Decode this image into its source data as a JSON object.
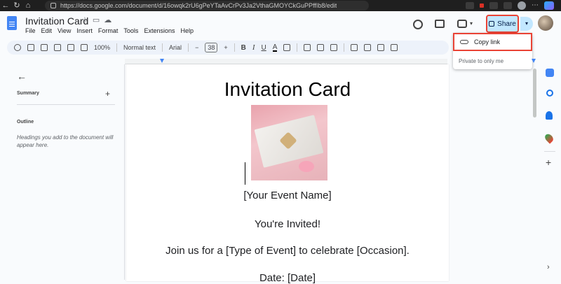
{
  "browser": {
    "url": "https://docs.google.com/document/d/16owqk2rU6gPeYTaAvCrPv3Ja2VthaGMOYCkGuPPffIb8/edit"
  },
  "doc": {
    "title": "Invitation Card",
    "menu": [
      "File",
      "Edit",
      "View",
      "Insert",
      "Format",
      "Tools",
      "Extensions",
      "Help"
    ]
  },
  "toolbar": {
    "zoom": "100%",
    "style": "Normal text",
    "font": "Arial",
    "font_size": "38",
    "bold": "B",
    "italic": "I",
    "underline": "U",
    "text_color": "A"
  },
  "share": {
    "label": "Share",
    "copy_link": "Copy link",
    "private": "Private to only me"
  },
  "outline_panel": {
    "summary": "Summary",
    "outline": "Outline",
    "hint": "Headings you add to the document will appear here."
  },
  "page": {
    "heading": "Invitation Card",
    "lines": [
      "[Your Event Name]",
      "You're Invited!",
      "Join us for a [Type of Event] to celebrate [Occasion].",
      "Date: [Date]"
    ]
  },
  "colors": {
    "share_bg": "#c2e7ff",
    "highlight": "#ea4335",
    "docs_blue": "#4285f4"
  }
}
